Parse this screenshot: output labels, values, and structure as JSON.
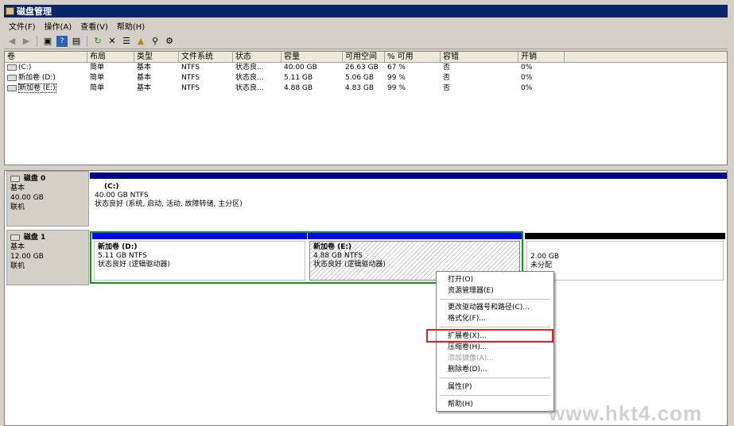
{
  "window": {
    "title": "磁盘管理"
  },
  "menu": {
    "items": [
      "文件(F)",
      "操作(A)",
      "查看(V)",
      "帮助(H)"
    ]
  },
  "toolbar": {
    "icons": [
      "back-icon",
      "forward-icon",
      "console-icon",
      "help-icon",
      "view-icon",
      "refresh-icon",
      "delete-icon",
      "properties-icon",
      "open-icon",
      "search-icon",
      "settings-icon"
    ]
  },
  "table": {
    "headers": [
      "卷",
      "布局",
      "类型",
      "文件系统",
      "状态",
      "容量",
      "可用空间",
      "% 可用",
      "容错",
      "开销"
    ],
    "rows": [
      [
        "(C:)",
        "简单",
        "基本",
        "NTFS",
        "状态良...",
        "40.00 GB",
        "26.63 GB",
        "67 %",
        "否",
        "0%"
      ],
      [
        "新加卷 (D:)",
        "简单",
        "基本",
        "NTFS",
        "状态良...",
        "5.11 GB",
        "5.06 GB",
        "99 %",
        "否",
        "0%"
      ],
      [
        "新加卷 (E:)",
        "简单",
        "基本",
        "NTFS",
        "状态良...",
        "4.88 GB",
        "4.83 GB",
        "99 %",
        "否",
        "0%"
      ]
    ]
  },
  "disks": [
    {
      "name": "磁盘 0",
      "type": "基本",
      "size": "40.00 GB",
      "status": "联机",
      "volumes": [
        {
          "name": "(C:)",
          "size": "40.00 GB NTFS",
          "status": "状态良好 (系统, 启动, 活动, 故障转储, 主分区)"
        }
      ]
    },
    {
      "name": "磁盘 1",
      "type": "基本",
      "size": "12.00 GB",
      "status": "联机",
      "volumes": [
        {
          "name": "新加卷  (D:)",
          "size": "5.11 GB NTFS",
          "status": "状态良好 (逻辑驱动器)"
        },
        {
          "name": "新加卷  (E:)",
          "size": "4.88 GB NTFS",
          "status": "状态良好 (逻辑驱动器)"
        }
      ],
      "unallocated": {
        "size": "2.00 GB",
        "label": "未分配"
      }
    }
  ],
  "context_menu": {
    "items": [
      {
        "label": "打开(O)",
        "enabled": true
      },
      {
        "label": "资源管理器(E)",
        "enabled": true
      },
      {
        "label": "更改驱动器号和路径(C)...",
        "enabled": true
      },
      {
        "label": "格式化(F)...",
        "enabled": true
      },
      {
        "label": "扩展卷(X)...",
        "enabled": true,
        "highlighted": true
      },
      {
        "label": "压缩卷(H)...",
        "enabled": true
      },
      {
        "label": "添加镜像(A)...",
        "enabled": false
      },
      {
        "label": "删除卷(D)...",
        "enabled": true
      },
      {
        "label": "属性(P)",
        "enabled": true
      },
      {
        "label": "帮助(H)",
        "enabled": true
      }
    ]
  },
  "watermark": "www.hkt4.com",
  "colors": {
    "primary_partition": "#00008b",
    "logical_drive": "#0000ff",
    "extended_partition": "#00a000",
    "unallocated": "#000000",
    "highlight_box": "#e02020"
  }
}
